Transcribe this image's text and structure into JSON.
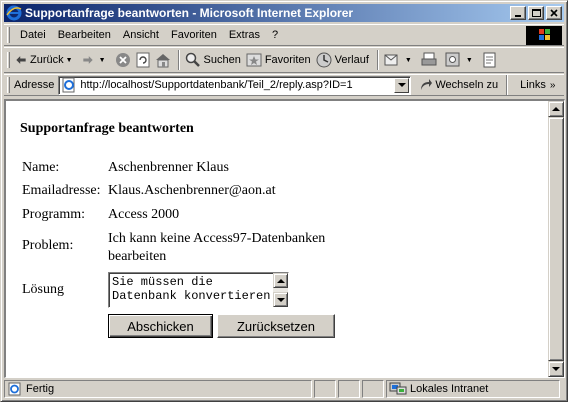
{
  "window": {
    "title": "Supportanfrage beantworten - Microsoft Internet Explorer"
  },
  "menu": [
    "Datei",
    "Bearbeiten",
    "Ansicht",
    "Favoriten",
    "Extras",
    "?"
  ],
  "toolbar": {
    "back": "Zurück",
    "search": "Suchen",
    "favorites": "Favoriten",
    "history": "Verlauf"
  },
  "address": {
    "label": "Adresse",
    "url": "http://localhost/Supportdatenbank/Teil_2/reply.asp?ID=1",
    "go": "Wechseln zu",
    "links": "Links"
  },
  "page": {
    "heading": "Supportanfrage beantworten",
    "fields": {
      "name_label": "Name:",
      "name_value": "Aschenbrenner Klaus",
      "email_label": "Emailadresse:",
      "email_value": "Klaus.Aschenbrenner@aon.at",
      "program_label": "Programm:",
      "program_value": "Access 2000",
      "problem_label": "Problem:",
      "problem_value": "Ich kann keine Access97-Datenbanken bearbeiten",
      "solution_label": "Lösung"
    },
    "solution_text": "Sie müssen die Datenbank konvertieren",
    "submit": "Abschicken",
    "reset": "Zurücksetzen"
  },
  "status": {
    "text": "Fertig",
    "zone": "Lokales Intranet"
  },
  "colors": {
    "title_start": "#0a246a",
    "title_end": "#a6caf0",
    "face": "#d4d0c8"
  }
}
